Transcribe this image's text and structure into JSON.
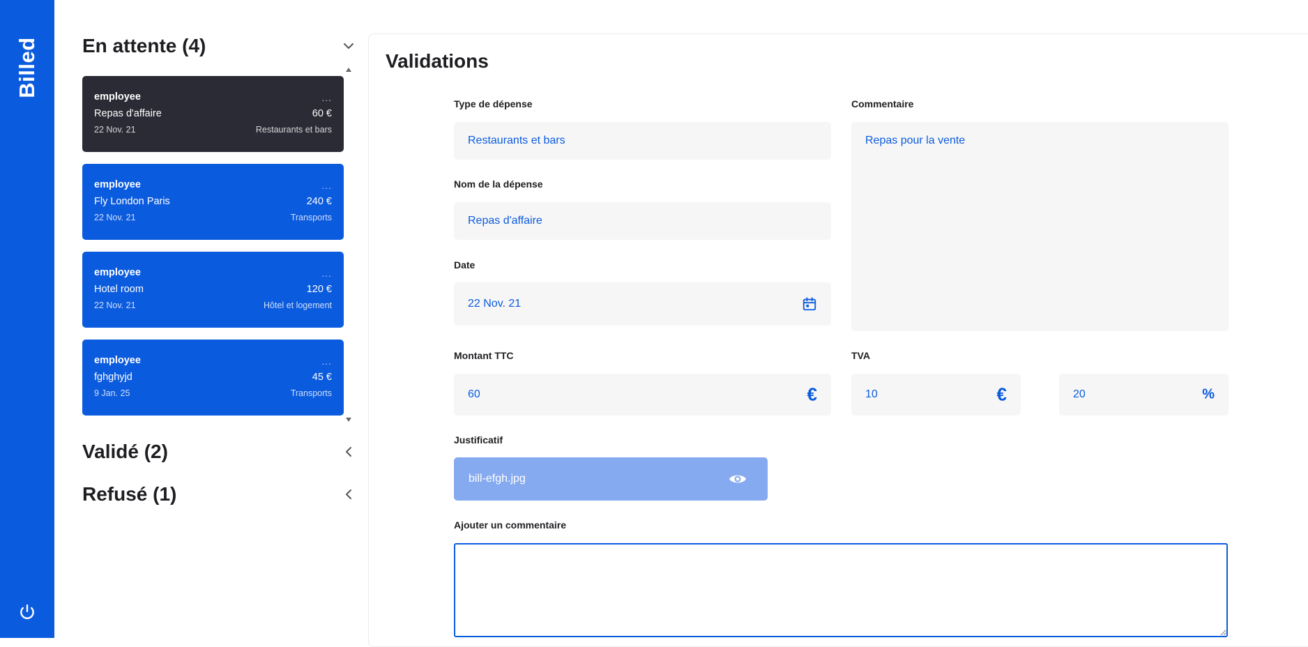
{
  "app": {
    "brand": "Billed"
  },
  "colors": {
    "brand": "#0b5bde",
    "selected_card": "#2a2b35",
    "field_bg": "#f6f6f6",
    "attachment_bg": "#86aaf0"
  },
  "sections": {
    "pending": {
      "title": "En attente (4)"
    },
    "valid": {
      "title": "Validé (2)"
    },
    "refused": {
      "title": "Refusé (1)"
    }
  },
  "bills": [
    {
      "email": "employee",
      "dots": "...",
      "name": "Repas d'affaire",
      "amount": "60 €",
      "date": "22 Nov. 21",
      "type": "Restaurants et bars",
      "selected": true
    },
    {
      "email": "employee",
      "dots": "...",
      "name": "Fly London Paris",
      "amount": "240 €",
      "date": "22 Nov. 21",
      "type": "Transports",
      "selected": false
    },
    {
      "email": "employee",
      "dots": "...",
      "name": "Hotel room",
      "amount": "120 €",
      "date": "22 Nov. 21",
      "type": "Hôtel et logement",
      "selected": false
    },
    {
      "email": "employee",
      "dots": "...",
      "name": "fghghyjd",
      "amount": "45 €",
      "date": "9 Jan. 25",
      "type": "Transports",
      "selected": false
    }
  ],
  "form": {
    "title": "Validations",
    "type_label": "Type de dépense",
    "type_value": "Restaurants et bars",
    "name_label": "Nom de la dépense",
    "name_value": "Repas d'affaire",
    "date_label": "Date",
    "date_value": "22 Nov. 21",
    "comment_label": "Commentaire",
    "comment_value": "Repas pour la vente",
    "amount_label": "Montant TTC",
    "amount_value": "60",
    "amount_unit": "€",
    "vat_label": "TVA",
    "vat_value": "10",
    "vat_unit": "€",
    "pct_value": "20",
    "pct_unit": "%",
    "justif_label": "Justificatif",
    "justif_file": "bill-efgh.jpg",
    "add_comment_label": "Ajouter un commentaire",
    "add_comment_value": ""
  },
  "icons": {
    "power": "power-icon",
    "calendar": "calendar-icon",
    "euro": "euro-icon",
    "percent": "percent-icon",
    "eye": "eye-icon",
    "chevron_down": "chevron-down-icon",
    "chevron_left": "chevron-left-icon"
  }
}
